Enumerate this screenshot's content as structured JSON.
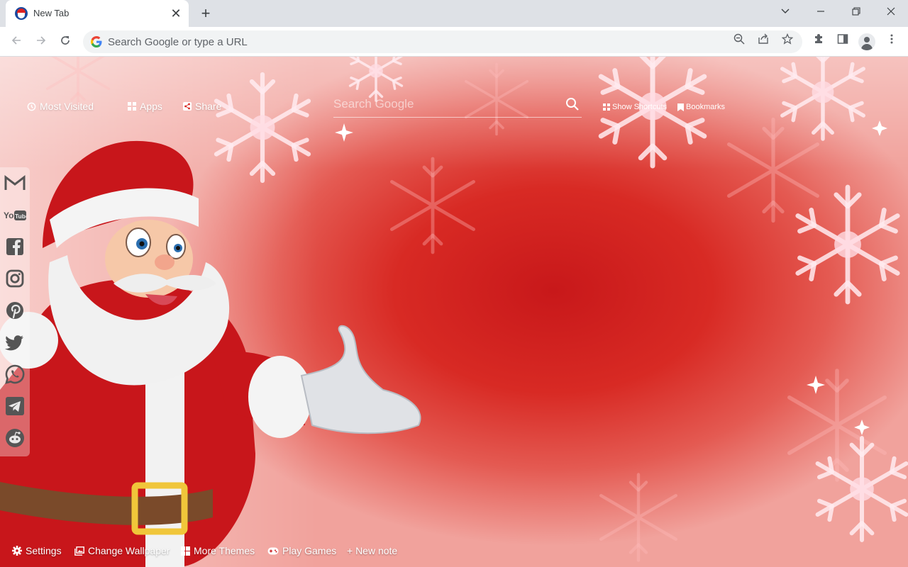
{
  "browser": {
    "tab": {
      "title": "New Tab",
      "close_glyph": "✕"
    },
    "new_tab_glyph": "+",
    "window_controls": {
      "tab_search": "⌄",
      "minimize": "—",
      "restore": "❐",
      "close": "✕"
    },
    "omnibox": {
      "placeholder": "Search Google or type a URL",
      "value": ""
    }
  },
  "page": {
    "top_links": {
      "most_visited": "Most Visited",
      "apps": "Apps",
      "share": "Share"
    },
    "search": {
      "placeholder": "Search Google"
    },
    "shortcuts": {
      "show_shortcuts": "Show Shortcuts",
      "bookmarks": "Bookmarks"
    },
    "social": [
      {
        "name": "Gmail",
        "icon": "gmail-icon"
      },
      {
        "name": "YouTube",
        "icon": "youtube-icon"
      },
      {
        "name": "Facebook",
        "icon": "facebook-icon"
      },
      {
        "name": "Instagram",
        "icon": "instagram-icon"
      },
      {
        "name": "Pinterest",
        "icon": "pinterest-icon"
      },
      {
        "name": "Twitter",
        "icon": "twitter-icon"
      },
      {
        "name": "WhatsApp",
        "icon": "whatsapp-icon"
      },
      {
        "name": "Telegram",
        "icon": "telegram-icon"
      },
      {
        "name": "Reddit",
        "icon": "reddit-icon"
      }
    ],
    "youtube_label": "You",
    "youtube_label2": "Tube",
    "bottom_bar": {
      "settings": "Settings",
      "change_wallpaper": "Change Wallpaper",
      "more_themes": "More Themes",
      "play_games": "Play Games",
      "new_note": "+ New note"
    }
  },
  "colors": {
    "wallpaper_red": "#d82a24",
    "wallpaper_light": "#f1a29c",
    "tabstrip": "#dee1e6",
    "omnibox_bg": "#f1f3f4"
  }
}
